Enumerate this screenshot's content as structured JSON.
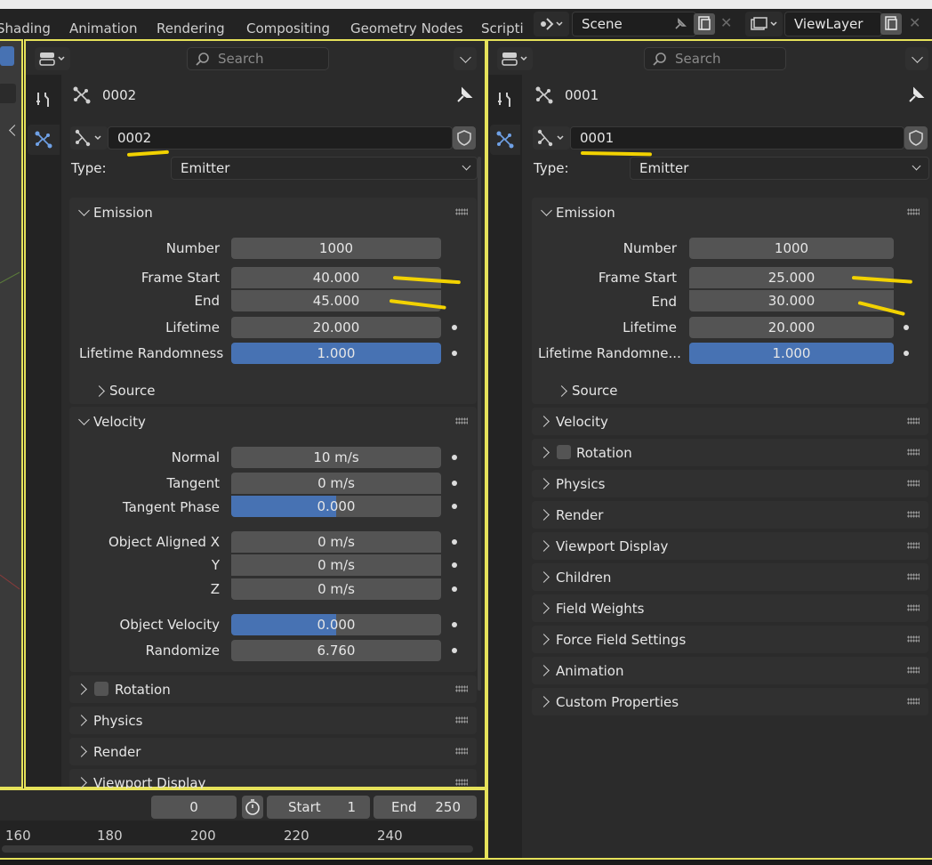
{
  "workspace_tabs": [
    "Shading",
    "Animation",
    "Rendering",
    "Compositing",
    "Geometry Nodes",
    "Scripti"
  ],
  "scene": {
    "name": "Scene"
  },
  "view_layer": {
    "name": "ViewLayer"
  },
  "left_panel": {
    "search_placeholder": "Search",
    "header_name": "0002",
    "datablock_name": "0002",
    "type_label": "Type:",
    "type_value": "Emitter",
    "emission": {
      "title": "Emission",
      "rows": [
        {
          "label": "Number",
          "value": "1000"
        },
        {
          "label": "Frame Start",
          "value": "40.000"
        },
        {
          "label": "End",
          "value": "45.000"
        },
        {
          "label": "Lifetime",
          "value": "20.000"
        },
        {
          "label": "Lifetime Randomness",
          "value": "1.000"
        }
      ],
      "source": "Source"
    },
    "velocity": {
      "title": "Velocity",
      "rows": [
        {
          "label": "Normal",
          "value": "10 m/s"
        },
        {
          "label": "Tangent",
          "value": "0 m/s"
        },
        {
          "label": "Tangent Phase",
          "value": "0.000"
        },
        {
          "label": "Object Aligned X",
          "value": "0 m/s"
        },
        {
          "label": "Y",
          "value": "0 m/s"
        },
        {
          "label": "Z",
          "value": "0 m/s"
        },
        {
          "label": "Object Velocity",
          "value": "0.000"
        },
        {
          "label": "Randomize",
          "value": "6.760"
        }
      ]
    },
    "collapsed": [
      "Rotation",
      "Physics",
      "Render",
      "Viewport Display"
    ]
  },
  "right_panel": {
    "search_placeholder": "Search",
    "header_name": "0001",
    "datablock_name": "0001",
    "type_label": "Type:",
    "type_value": "Emitter",
    "emission": {
      "title": "Emission",
      "rows": [
        {
          "label": "Number",
          "value": "1000"
        },
        {
          "label": "Frame Start",
          "value": "25.000"
        },
        {
          "label": "End",
          "value": "30.000"
        },
        {
          "label": "Lifetime",
          "value": "20.000"
        },
        {
          "label": "Lifetime Randomne...",
          "value": "1.000"
        }
      ],
      "source": "Source"
    },
    "collapsed": [
      "Velocity",
      "Rotation",
      "Physics",
      "Render",
      "Viewport Display",
      "Children",
      "Field Weights",
      "Force Field Settings",
      "Animation",
      "Custom Properties"
    ]
  },
  "timeline": {
    "current_frame": "0",
    "start_label": "Start",
    "start_value": "1",
    "end_label": "End",
    "end_value": "250",
    "ticks": [
      "160",
      "180",
      "200",
      "220",
      "240"
    ]
  },
  "colors": {
    "accent_blue": "#4772b3",
    "outline_yellow": "#e6e25a",
    "annotation_yellow": "#f2d200"
  }
}
